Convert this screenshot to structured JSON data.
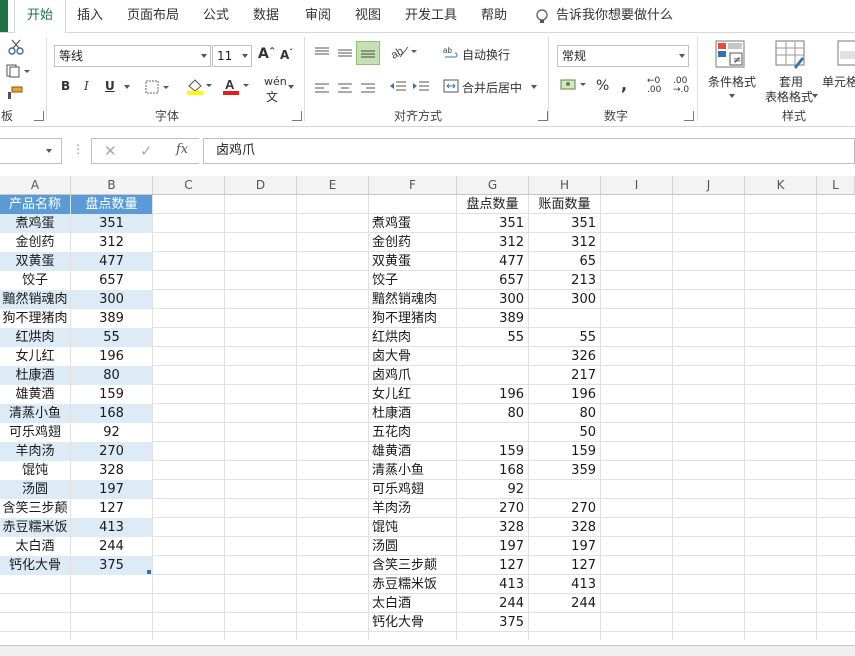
{
  "tabs": [
    "开始",
    "插入",
    "页面布局",
    "公式",
    "数据",
    "审阅",
    "视图",
    "开发工具",
    "帮助"
  ],
  "tell_me": "告诉我你想要做什么",
  "font": {
    "name": "等线",
    "size": "11",
    "group_label": "字体"
  },
  "align": {
    "wrap": "自动换行",
    "merge": "合并后居中",
    "group_label": "对齐方式"
  },
  "number": {
    "format": "常规",
    "group_label": "数字"
  },
  "styles": {
    "cond": "条件格式",
    "table": "套用",
    "table2": "表格格式",
    "cell": "单元格",
    "group_label": "样式"
  },
  "clipboard_label": "板",
  "formula": {
    "fx": "fx",
    "value": "卤鸡爪"
  },
  "columns": [
    "A",
    "B",
    "C",
    "D",
    "E",
    "F",
    "G",
    "H",
    "I",
    "J",
    "K",
    "L"
  ],
  "table1": {
    "headers": [
      "产品名称",
      "盘点数量"
    ],
    "rows": [
      [
        "煮鸡蛋",
        "351"
      ],
      [
        "金创药",
        "312"
      ],
      [
        "双黄蛋",
        "477"
      ],
      [
        "饺子",
        "657"
      ],
      [
        "黯然销魂肉",
        "300"
      ],
      [
        "狗不理猪肉",
        "389"
      ],
      [
        "红烘肉",
        "55"
      ],
      [
        "女儿红",
        "196"
      ],
      [
        "杜康酒",
        "80"
      ],
      [
        "雄黄酒",
        "159"
      ],
      [
        "清蒸小鱼",
        "168"
      ],
      [
        "可乐鸡翅",
        "92"
      ],
      [
        "羊肉汤",
        "270"
      ],
      [
        "馄饨",
        "328"
      ],
      [
        "汤圆",
        "197"
      ],
      [
        "含笑三步颠",
        "127"
      ],
      [
        "赤豆糯米饭",
        "413"
      ],
      [
        "太白酒",
        "244"
      ],
      [
        "钙化大骨",
        "375"
      ]
    ]
  },
  "table2": {
    "headers": [
      "盘点数量",
      "账面数量"
    ],
    "rows": [
      [
        "煮鸡蛋",
        "351",
        "351"
      ],
      [
        "金创药",
        "312",
        "312"
      ],
      [
        "双黄蛋",
        "477",
        "65"
      ],
      [
        "饺子",
        "657",
        "213"
      ],
      [
        "黯然销魂肉",
        "300",
        "300"
      ],
      [
        "狗不理猪肉",
        "389",
        ""
      ],
      [
        "红烘肉",
        "55",
        "55"
      ],
      [
        "卤大骨",
        "",
        "326"
      ],
      [
        "卤鸡爪",
        "",
        "217"
      ],
      [
        "女儿红",
        "196",
        "196"
      ],
      [
        "杜康酒",
        "80",
        "80"
      ],
      [
        "五花肉",
        "",
        "50"
      ],
      [
        "雄黄酒",
        "159",
        "159"
      ],
      [
        "清蒸小鱼",
        "168",
        "359"
      ],
      [
        "可乐鸡翅",
        "92",
        ""
      ],
      [
        "羊肉汤",
        "270",
        "270"
      ],
      [
        "馄饨",
        "328",
        "328"
      ],
      [
        "汤圆",
        "197",
        "197"
      ],
      [
        "含笑三步颠",
        "127",
        "127"
      ],
      [
        "赤豆糯米饭",
        "413",
        "413"
      ],
      [
        "太白酒",
        "244",
        "244"
      ],
      [
        "钙化大骨",
        "375",
        ""
      ]
    ]
  },
  "colors": {
    "accent": "#217346",
    "header_fill": "#5b9bd5",
    "band_fill": "#ddebf7"
  }
}
